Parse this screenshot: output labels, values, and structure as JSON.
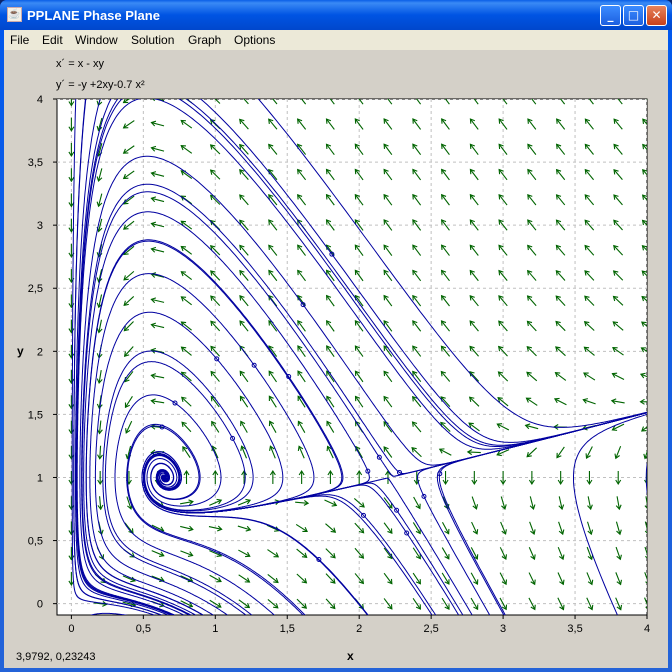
{
  "window": {
    "title": "PPLANE Phase Plane",
    "minimize": "_",
    "maximize": "□",
    "close": "✕"
  },
  "menu": [
    "File",
    "Edit",
    "Window",
    "Solution",
    "Graph",
    "Options"
  ],
  "equations": {
    "x": "x´ = x - xy",
    "y": "y´ = -y +2xy-0.7 x²"
  },
  "status": "3,9792,  0,23243",
  "colors": {
    "trajectory": "#0000a0",
    "field": "#006400",
    "grid": "#c0c0c0"
  },
  "chart_data": {
    "type": "phase-plane",
    "xlabel": "x",
    "ylabel": "y",
    "xlim": [
      -0.1,
      4
    ],
    "ylim": [
      -0.09,
      4
    ],
    "grid": true,
    "xticks": [
      {
        "v": 0,
        "t": "0"
      },
      {
        "v": 0.5,
        "t": "0,5"
      },
      {
        "v": 1,
        "t": "1"
      },
      {
        "v": 1.5,
        "t": "1,5"
      },
      {
        "v": 2,
        "t": "2"
      },
      {
        "v": 2.5,
        "t": "2,5"
      },
      {
        "v": 3,
        "t": "3"
      },
      {
        "v": 3.5,
        "t": "3,5"
      },
      {
        "v": 4,
        "t": "4"
      }
    ],
    "yticks": [
      {
        "v": 0,
        "t": "0"
      },
      {
        "v": 0.5,
        "t": "0,5"
      },
      {
        "v": 1,
        "t": "1"
      },
      {
        "v": 1.5,
        "t": "1,5"
      },
      {
        "v": 2,
        "t": "2"
      },
      {
        "v": 2.5,
        "t": "2,5"
      },
      {
        "v": 3,
        "t": "3"
      },
      {
        "v": 3.5,
        "t": "3,5"
      },
      {
        "v": 4,
        "t": "4"
      }
    ],
    "initial_points": [
      [
        1.81,
        2.77
      ],
      [
        1.61,
        2.37
      ],
      [
        1.51,
        1.8
      ],
      [
        1.27,
        1.89
      ],
      [
        1.01,
        1.94
      ],
      [
        0.72,
        1.59
      ],
      [
        0.63,
        1.4
      ],
      [
        1.12,
        1.31
      ],
      [
        2.06,
        1.05
      ],
      [
        2.14,
        1.16
      ],
      [
        2.28,
        1.04
      ],
      [
        2.56,
        1.03
      ],
      [
        2.45,
        0.85
      ],
      [
        2.26,
        0.74
      ],
      [
        2.03,
        0.7
      ],
      [
        1.72,
        0.35
      ],
      [
        2.33,
        0.56
      ]
    ]
  }
}
